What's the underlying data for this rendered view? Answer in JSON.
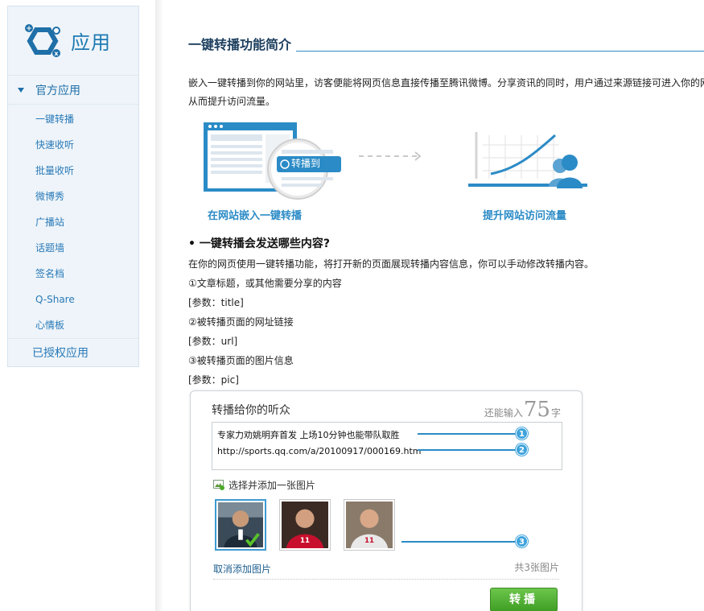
{
  "sidebar": {
    "title": "应用",
    "group_label": "官方应用",
    "items": [
      "一键转播",
      "快速收听",
      "批量收听",
      "微博秀",
      "广播站",
      "话题墙",
      "签名档",
      "Q-Share",
      "心情板"
    ],
    "authorized_label": "已授权应用"
  },
  "main": {
    "title": "一键转播功能简介",
    "intro_line1": "嵌入一键转播到你的网站里，访客便能将网页信息直接传播至腾讯微博。分享资讯的同时，用户通过来源链接可进入你的网",
    "intro_line2": "从而提升访问流量。",
    "illustration": {
      "button_label": "转播到",
      "caption_left": "在网站嵌入一键转播",
      "caption_right": "提升网站访问流量"
    },
    "section_heading": "• 一键转播会发送哪些内容?",
    "section_intro": "在你的网页使用一键转播功能，将打开新的页面展现转播内容信息，你可以手动修改转播内容。",
    "params": [
      "①文章标题，或其他需要分享的内容",
      "[参数：title]",
      "②被转播页面的网址链接",
      "[参数：url]",
      "③被转播页面的图片信息",
      "[参数：pic]"
    ]
  },
  "share_panel": {
    "heading": "转播给你的听众",
    "count_prefix": "还能输入",
    "count_value": "75",
    "count_suffix": "字",
    "text_line1": "专家力劝姚明弃首发  上场10分钟也能带队取胜",
    "text_line2": "http://sports.qq.com/a/20100917/000169.htm",
    "add_image_label": "选择并添加一张图片",
    "cancel_label": "取消添加图片",
    "total_label": "共3张图片",
    "submit_label": "转播",
    "badges": [
      "1",
      "2",
      "3"
    ]
  }
}
